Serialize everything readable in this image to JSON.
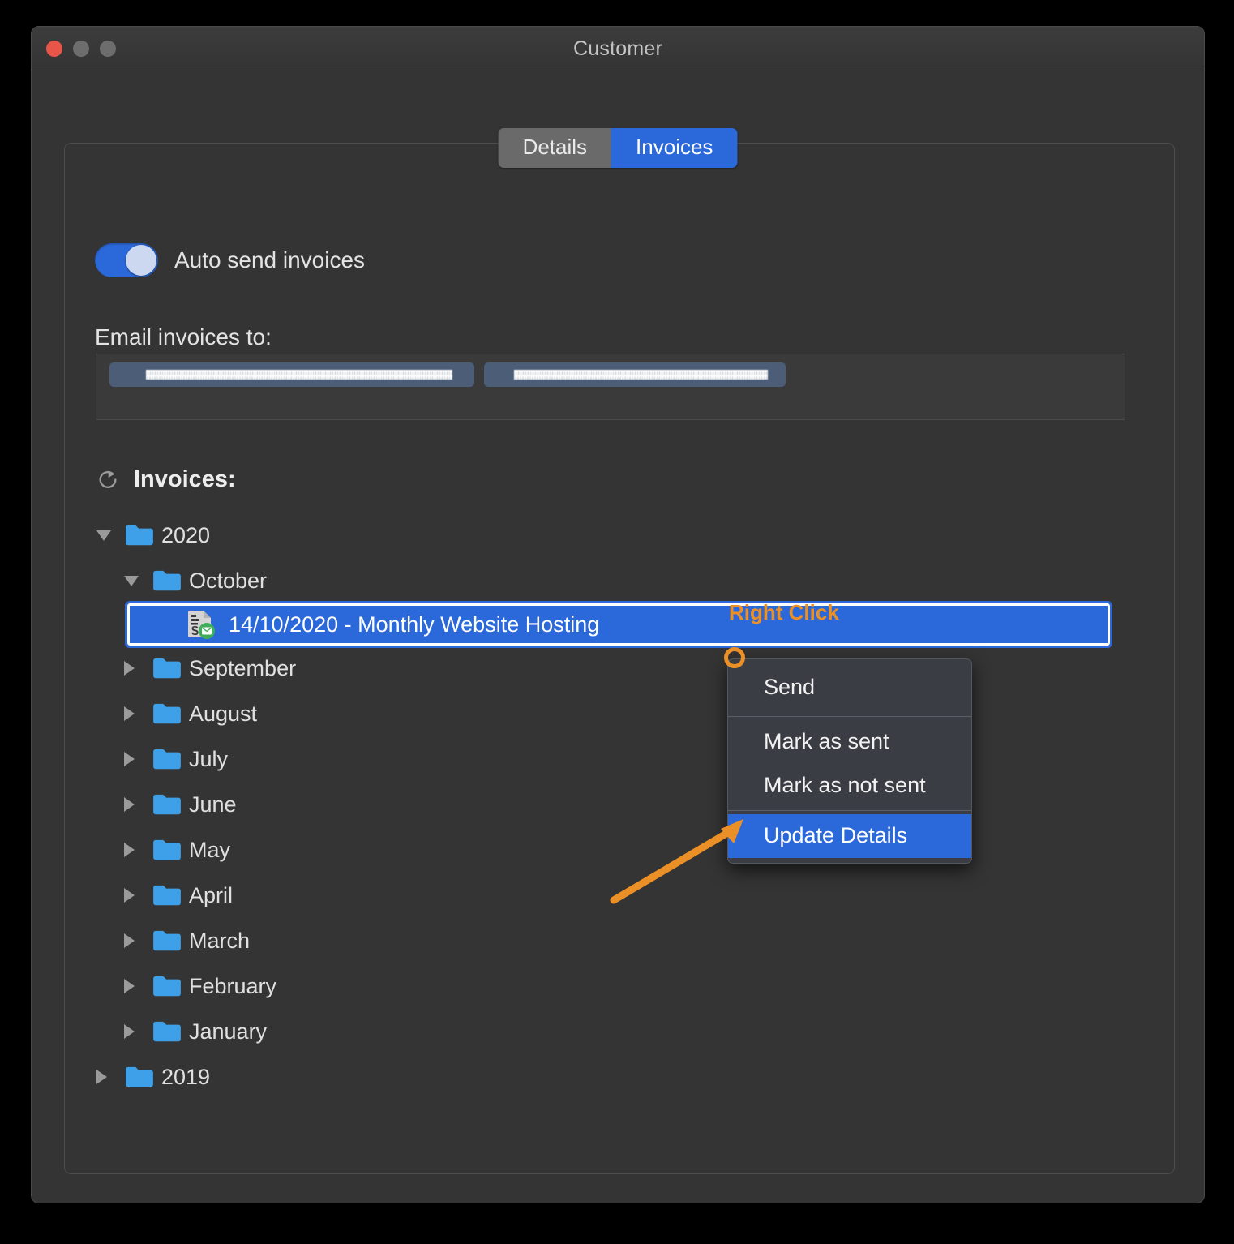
{
  "window": {
    "title": "Customer",
    "traffic_lights": [
      "close-button",
      "minimize-button",
      "maximize-button"
    ]
  },
  "tabs": {
    "details_label": "Details",
    "invoices_label": "Invoices",
    "selected": "Invoices"
  },
  "auto_send": {
    "label": "Auto send invoices",
    "state": "on"
  },
  "email": {
    "label": "Email invoices to:",
    "tokens": [
      {
        "value": "",
        "redacted": true
      },
      {
        "value": "",
        "redacted": true
      }
    ]
  },
  "invoices": {
    "header": "Invoices:",
    "refresh_icon": "refresh-icon",
    "tree": [
      {
        "label": "2020",
        "level": 1,
        "expanded": true,
        "type": "folder"
      },
      {
        "label": "October",
        "level": 2,
        "expanded": true,
        "type": "folder"
      },
      {
        "label": "14/10/2020 - Monthly Website Hosting",
        "level": 3,
        "type": "invoice",
        "selected": true,
        "icon": "invoice-email-icon"
      },
      {
        "label": "September",
        "level": 2,
        "expanded": false,
        "type": "folder"
      },
      {
        "label": "August",
        "level": 2,
        "expanded": false,
        "type": "folder"
      },
      {
        "label": "July",
        "level": 2,
        "expanded": false,
        "type": "folder"
      },
      {
        "label": "June",
        "level": 2,
        "expanded": false,
        "type": "folder"
      },
      {
        "label": "May",
        "level": 2,
        "expanded": false,
        "type": "folder"
      },
      {
        "label": "April",
        "level": 2,
        "expanded": false,
        "type": "folder"
      },
      {
        "label": "March",
        "level": 2,
        "expanded": false,
        "type": "folder"
      },
      {
        "label": "February",
        "level": 2,
        "expanded": false,
        "type": "folder"
      },
      {
        "label": "January",
        "level": 2,
        "expanded": false,
        "type": "folder"
      },
      {
        "label": "2019",
        "level": 1,
        "expanded": false,
        "type": "folder"
      }
    ]
  },
  "context_menu": {
    "items": [
      {
        "label": "Send",
        "highlighted": false
      },
      {
        "label": "Mark as sent",
        "highlighted": false
      },
      {
        "label": "Mark as not sent",
        "highlighted": false
      },
      {
        "label": "Update Details",
        "highlighted": true
      }
    ]
  },
  "annotations": {
    "right_click_label": "Right Click",
    "accent_color": "#eb9026",
    "marker": "click-point-circle",
    "arrow": "arrow-to-update-details"
  },
  "colors": {
    "accent_blue": "#2b68d9",
    "folder_blue": "#3da0e8",
    "annotation_orange": "#eb9026",
    "window_bg": "#343434",
    "menu_bg": "#3a3e44",
    "token_bg": "#4c5d77"
  }
}
